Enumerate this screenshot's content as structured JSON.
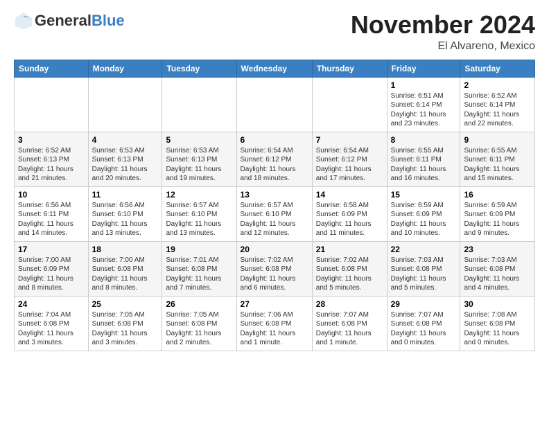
{
  "logo": {
    "general": "General",
    "blue": "Blue"
  },
  "header": {
    "month": "November 2024",
    "location": "El Alvareno, Mexico"
  },
  "weekdays": [
    "Sunday",
    "Monday",
    "Tuesday",
    "Wednesday",
    "Thursday",
    "Friday",
    "Saturday"
  ],
  "weeks": [
    [
      {
        "day": "",
        "info": ""
      },
      {
        "day": "",
        "info": ""
      },
      {
        "day": "",
        "info": ""
      },
      {
        "day": "",
        "info": ""
      },
      {
        "day": "",
        "info": ""
      },
      {
        "day": "1",
        "info": "Sunrise: 6:51 AM\nSunset: 6:14 PM\nDaylight: 11 hours and 23 minutes."
      },
      {
        "day": "2",
        "info": "Sunrise: 6:52 AM\nSunset: 6:14 PM\nDaylight: 11 hours and 22 minutes."
      }
    ],
    [
      {
        "day": "3",
        "info": "Sunrise: 6:52 AM\nSunset: 6:13 PM\nDaylight: 11 hours and 21 minutes."
      },
      {
        "day": "4",
        "info": "Sunrise: 6:53 AM\nSunset: 6:13 PM\nDaylight: 11 hours and 20 minutes."
      },
      {
        "day": "5",
        "info": "Sunrise: 6:53 AM\nSunset: 6:13 PM\nDaylight: 11 hours and 19 minutes."
      },
      {
        "day": "6",
        "info": "Sunrise: 6:54 AM\nSunset: 6:12 PM\nDaylight: 11 hours and 18 minutes."
      },
      {
        "day": "7",
        "info": "Sunrise: 6:54 AM\nSunset: 6:12 PM\nDaylight: 11 hours and 17 minutes."
      },
      {
        "day": "8",
        "info": "Sunrise: 6:55 AM\nSunset: 6:11 PM\nDaylight: 11 hours and 16 minutes."
      },
      {
        "day": "9",
        "info": "Sunrise: 6:55 AM\nSunset: 6:11 PM\nDaylight: 11 hours and 15 minutes."
      }
    ],
    [
      {
        "day": "10",
        "info": "Sunrise: 6:56 AM\nSunset: 6:11 PM\nDaylight: 11 hours and 14 minutes."
      },
      {
        "day": "11",
        "info": "Sunrise: 6:56 AM\nSunset: 6:10 PM\nDaylight: 11 hours and 13 minutes."
      },
      {
        "day": "12",
        "info": "Sunrise: 6:57 AM\nSunset: 6:10 PM\nDaylight: 11 hours and 13 minutes."
      },
      {
        "day": "13",
        "info": "Sunrise: 6:57 AM\nSunset: 6:10 PM\nDaylight: 11 hours and 12 minutes."
      },
      {
        "day": "14",
        "info": "Sunrise: 6:58 AM\nSunset: 6:09 PM\nDaylight: 11 hours and 11 minutes."
      },
      {
        "day": "15",
        "info": "Sunrise: 6:59 AM\nSunset: 6:09 PM\nDaylight: 11 hours and 10 minutes."
      },
      {
        "day": "16",
        "info": "Sunrise: 6:59 AM\nSunset: 6:09 PM\nDaylight: 11 hours and 9 minutes."
      }
    ],
    [
      {
        "day": "17",
        "info": "Sunrise: 7:00 AM\nSunset: 6:09 PM\nDaylight: 11 hours and 8 minutes."
      },
      {
        "day": "18",
        "info": "Sunrise: 7:00 AM\nSunset: 6:08 PM\nDaylight: 11 hours and 8 minutes."
      },
      {
        "day": "19",
        "info": "Sunrise: 7:01 AM\nSunset: 6:08 PM\nDaylight: 11 hours and 7 minutes."
      },
      {
        "day": "20",
        "info": "Sunrise: 7:02 AM\nSunset: 6:08 PM\nDaylight: 11 hours and 6 minutes."
      },
      {
        "day": "21",
        "info": "Sunrise: 7:02 AM\nSunset: 6:08 PM\nDaylight: 11 hours and 5 minutes."
      },
      {
        "day": "22",
        "info": "Sunrise: 7:03 AM\nSunset: 6:08 PM\nDaylight: 11 hours and 5 minutes."
      },
      {
        "day": "23",
        "info": "Sunrise: 7:03 AM\nSunset: 6:08 PM\nDaylight: 11 hours and 4 minutes."
      }
    ],
    [
      {
        "day": "24",
        "info": "Sunrise: 7:04 AM\nSunset: 6:08 PM\nDaylight: 11 hours and 3 minutes."
      },
      {
        "day": "25",
        "info": "Sunrise: 7:05 AM\nSunset: 6:08 PM\nDaylight: 11 hours and 3 minutes."
      },
      {
        "day": "26",
        "info": "Sunrise: 7:05 AM\nSunset: 6:08 PM\nDaylight: 11 hours and 2 minutes."
      },
      {
        "day": "27",
        "info": "Sunrise: 7:06 AM\nSunset: 6:08 PM\nDaylight: 11 hours and 1 minute."
      },
      {
        "day": "28",
        "info": "Sunrise: 7:07 AM\nSunset: 6:08 PM\nDaylight: 11 hours and 1 minute."
      },
      {
        "day": "29",
        "info": "Sunrise: 7:07 AM\nSunset: 6:08 PM\nDaylight: 11 hours and 0 minutes."
      },
      {
        "day": "30",
        "info": "Sunrise: 7:08 AM\nSunset: 6:08 PM\nDaylight: 11 hours and 0 minutes."
      }
    ]
  ]
}
